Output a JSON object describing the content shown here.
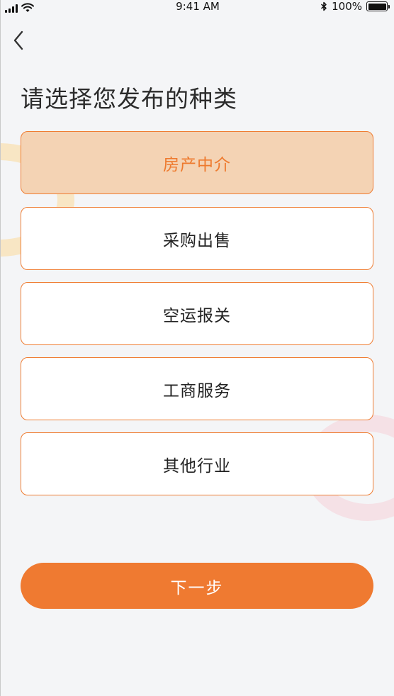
{
  "status_bar": {
    "time": "9:41 AM",
    "battery": "100%",
    "icons": [
      "signal-icon",
      "wifi-icon",
      "bluetooth-icon",
      "battery-icon"
    ]
  },
  "nav": {
    "back_icon": "chevron-left-icon"
  },
  "page": {
    "title": "请选择您发布的种类"
  },
  "categories": [
    {
      "label": "房产中介",
      "selected": true
    },
    {
      "label": "采购出售",
      "selected": false
    },
    {
      "label": "空运报关",
      "selected": false
    },
    {
      "label": "工商服务",
      "selected": false
    },
    {
      "label": "其他行业",
      "selected": false
    }
  ],
  "actions": {
    "next_label": "下一步"
  },
  "colors": {
    "accent": "#ef7a31",
    "selected_bg": "#f4d3b4",
    "selected_text": "#ee7a2e",
    "border": "#ef7d33",
    "background": "#f4f5f7",
    "ring_left": "#f8e6c4",
    "ring_right": "#f5e1e6"
  }
}
